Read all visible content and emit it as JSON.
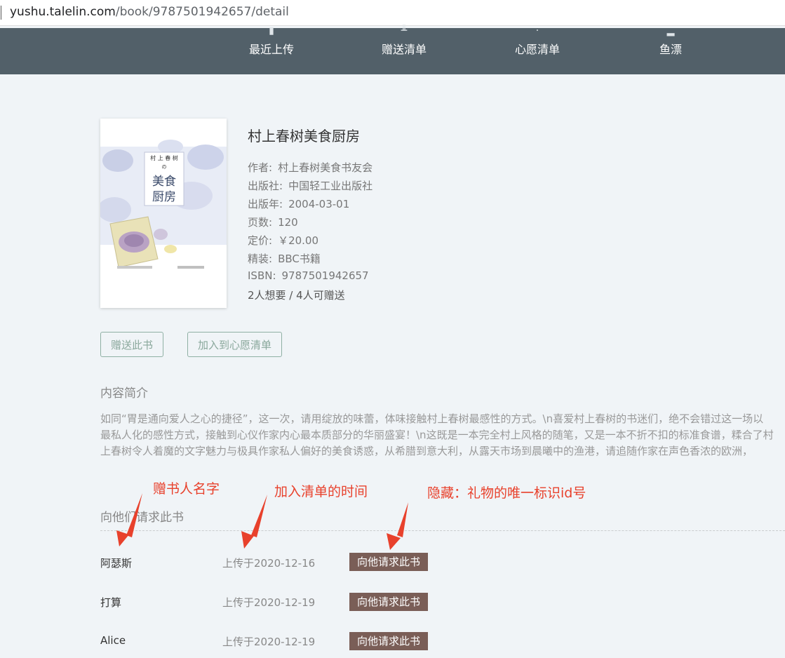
{
  "browser": {
    "url_domain": "yushu.talelin.com",
    "url_path": "/book/9787501942657/detail"
  },
  "nav": {
    "items": [
      {
        "label": "最近上传",
        "icon": "upload-icon"
      },
      {
        "label": "赠送清单",
        "icon": "gift-icon"
      },
      {
        "label": "心愿清单",
        "icon": "heart-icon"
      },
      {
        "label": "鱼漂",
        "icon": "float-icon"
      }
    ]
  },
  "book": {
    "title": "村上春树美食厨房",
    "cover_lines": [
      "村 上 春 树",
      "の",
      "美食",
      "厨房"
    ],
    "author_label": "作者:",
    "author": "村上春树美食书友会",
    "publisher_label": "出版社:",
    "publisher": "中国轻工业出版社",
    "pubdate_label": "出版年:",
    "pubdate": "2004-03-01",
    "pages_label": "页数:",
    "pages": "120",
    "price_label": "定价:",
    "price": "￥20.00",
    "binding_label": "精装:",
    "binding": "BBC书籍",
    "isbn_label": "ISBN:",
    "isbn": "9787501942657",
    "stats": "2人想要 / 4人可赠送"
  },
  "actions": {
    "gift_label": "赠送此书",
    "wish_label": "加入到心愿清单"
  },
  "summary": {
    "title": "内容简介",
    "text": "如同“胃是通向爱人之心的捷径”，这一次，请用绽放的味蕾，体味接触村上春树最感性的方式。\\n喜爱村上春树的书迷们，绝不会错过这一场以最私人化的感性方式，接触到心仪作家内心最本质部分的华丽盛宴！\\n这既是一本完全村上风格的随笔，又是一本不折不扣的标准食谱，糅合了村上春树令人着魔的文字魅力与极具作家私人偏好的美食诱惑，从希腊到意大利，从露天市场到晨曦中的渔港，请追随作家在声色香浓的欧洲，"
  },
  "gifts": {
    "title": "向他们请求此书",
    "rows": [
      {
        "name": "阿瑟斯",
        "date": "上传于2020-12-16",
        "button": "向他请求此书"
      },
      {
        "name": "打算",
        "date": "上传于2020-12-19",
        "button": "向他请求此书"
      },
      {
        "name": "Alice",
        "date": "上传于2020-12-19",
        "button": "向他请求此书"
      }
    ]
  },
  "annotations": {
    "giver_name": "赠书人名字",
    "added_time": "加入清单的时间",
    "hidden_id": "隐藏：礼物的唯一标识id号"
  },
  "colors": {
    "nav_bg": "#526069",
    "page_bg": "#f0f4f7",
    "request_button": "#7a5e57",
    "outline_button": "#8aa89c",
    "annotation": "#e8412c"
  }
}
